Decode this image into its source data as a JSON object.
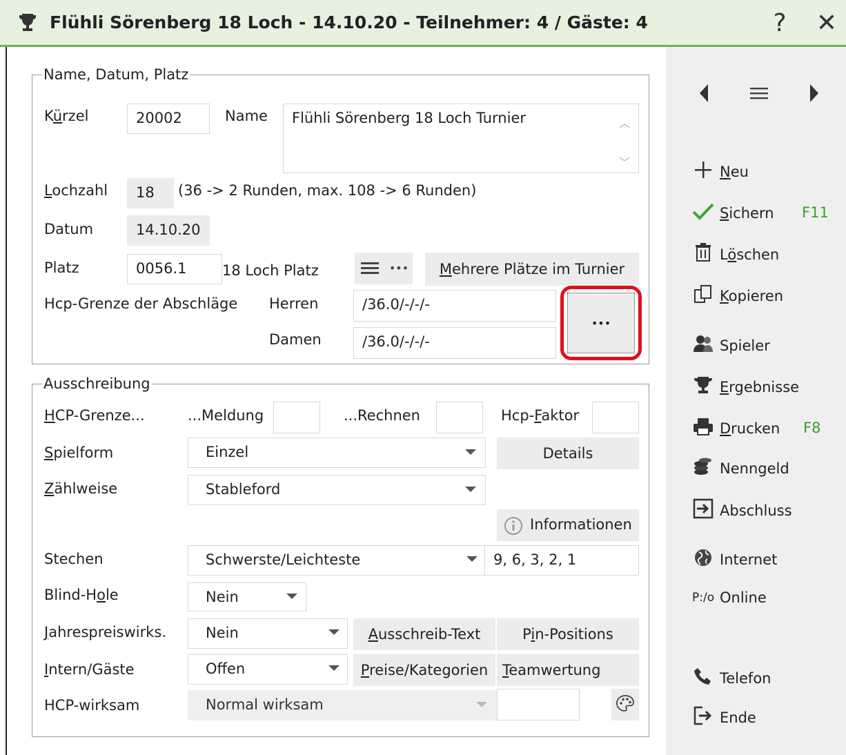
{
  "window": {
    "title": "Flühli Sörenberg 18 Loch - 14.10.20 - Teilnehmer: 4 / Gäste: 4",
    "help_label": "?",
    "close_label": "✕"
  },
  "group1": {
    "legend": "Name, Datum, Platz",
    "kuerzel_label": "Kürzel",
    "kuerzel_value": "20002",
    "name_label": "Name",
    "name_value": "Flühli Sörenberg 18 Loch Turnier",
    "lochzahl_label": "Lochzahl",
    "lochzahl_value": "18",
    "lochzahl_hint": "(36 -> 2 Runden, max. 108 -> 6 Runden)",
    "datum_label": "Datum",
    "datum_value": "14.10.20",
    "platz_label": "Platz",
    "platz_value": "0056.1",
    "platz_name": "18 Loch Platz",
    "mehrere_label": "Mehrere Plätze im Turnier",
    "hcp_grenze_label": "Hcp-Grenze der Abschläge",
    "herren_label": "Herren",
    "herren_value": "/36.0/-/-/-",
    "damen_label": "Damen",
    "damen_value": "/36.0/-/-/-",
    "dots_label": "•••"
  },
  "group2": {
    "legend": "Ausschreibung",
    "hcp_grenze_label": "HCP-Grenze...",
    "meldung_label": "...Meldung",
    "meldung_value": "",
    "rechnen_label": "...Rechnen",
    "rechnen_value": "",
    "faktor_label": "Hcp-Faktor",
    "faktor_value": "",
    "spielform_label": "Spielform",
    "spielform_value": "Einzel",
    "details_label": "Details",
    "zaehlweise_label": "Zählweise",
    "zaehlweise_value": "Stableford",
    "informationen_label": "Informationen",
    "stechen_label": "Stechen",
    "stechen_value": "Schwerste/Leichteste",
    "stechen_holes": "9, 6, 3, 2, 1",
    "blind_label": "Blind-Hole",
    "blind_value": "Nein",
    "jahres_label": "Jahrespreiswirks.",
    "jahres_value": "Nein",
    "ausschreib_label": "Ausschreib-Text",
    "pin_label": "Pin-Positions",
    "intern_label": "Intern/Gäste",
    "intern_value": "Offen",
    "preise_label": "Preise/Kategorien",
    "team_label": "Teamwertung",
    "hcpwirksam_label": "HCP-wirksam",
    "hcpwirksam_value": "Normal wirksam",
    "hcpwirksam_extra": ""
  },
  "sidebar": {
    "neu": "Neu",
    "sichern": "Sichern",
    "sichern_key": "F11",
    "loeschen": "Löschen",
    "kopieren": "Kopieren",
    "spieler": "Spieler",
    "ergebnisse": "Ergebnisse",
    "drucken": "Drucken",
    "drucken_key": "F8",
    "nenngeld": "Nenngeld",
    "abschluss": "Abschluss",
    "internet": "Internet",
    "online": "Online",
    "online_prefix": "P:/o",
    "telefon": "Telefon",
    "ende": "Ende"
  },
  "colors": {
    "title_bg": "#e7f1df",
    "title_border": "#6bb44c",
    "accent_green": "#3c9a2e",
    "highlight_red": "#e0101a",
    "sidebar_bg": "#efefef"
  }
}
